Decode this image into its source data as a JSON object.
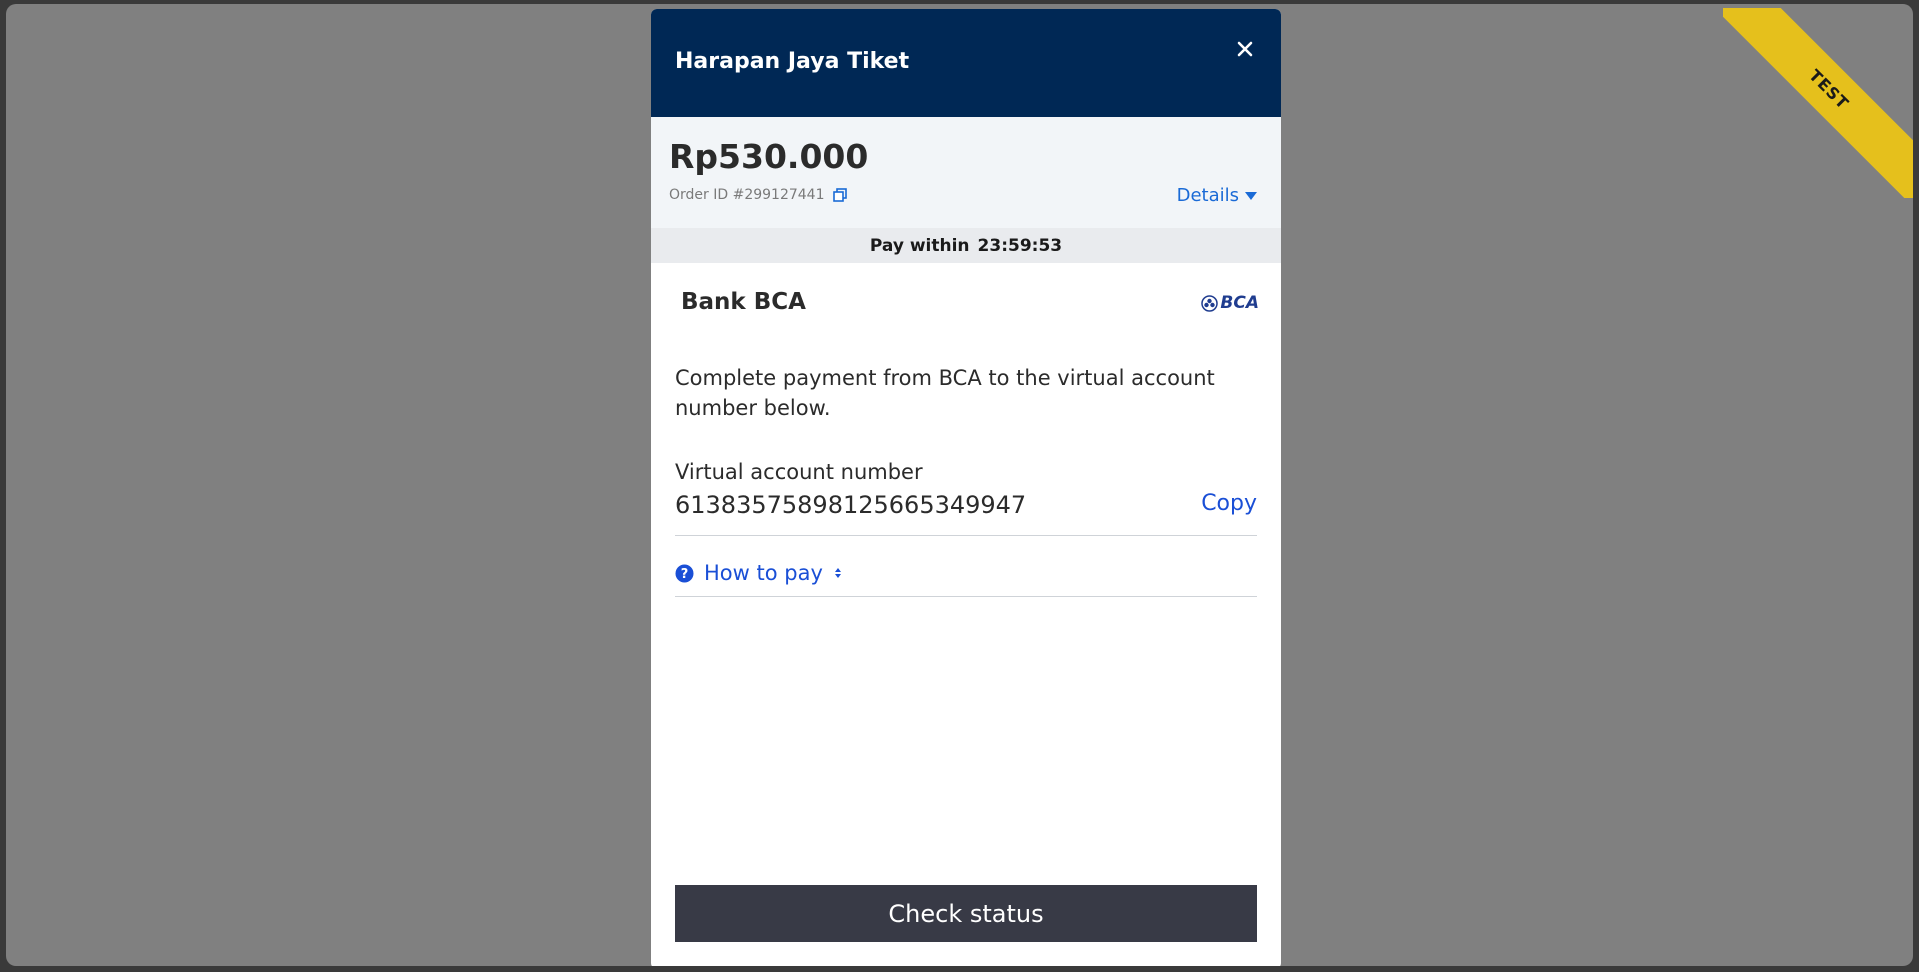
{
  "ribbon": {
    "label": "TEST"
  },
  "header": {
    "merchant_name": "Harapan Jaya Tiket",
    "close_icon": "close-icon"
  },
  "summary": {
    "amount": "Rp530.000",
    "order_id": "Order ID #299127441",
    "details_label": "Details"
  },
  "timer": {
    "label": "Pay within",
    "value": "23:59:53"
  },
  "payment": {
    "bank_name": "Bank BCA",
    "logo_text": "BCA",
    "instruction": "Complete payment from BCA to the virtual account number below.",
    "va_label": "Virtual account number",
    "va_number": "61383575898125665349947",
    "copy_label": "Copy",
    "how_to_pay_label": "How to pay"
  },
  "actions": {
    "check_status_label": "Check status"
  },
  "colors": {
    "header_bg": "#002855",
    "accent_link": "#1a4fd6",
    "ribbon": "#e5c01c",
    "button_bg": "#383a46"
  }
}
